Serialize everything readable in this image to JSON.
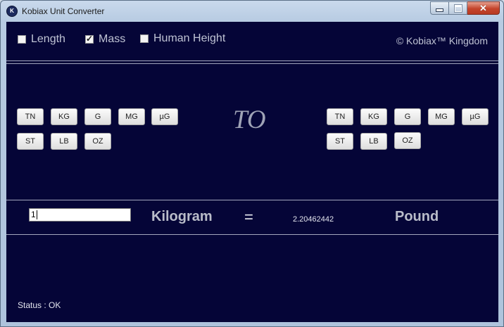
{
  "window": {
    "title": "Kobiax Unit Converter",
    "icon": "kobiax-logo-icon"
  },
  "topbar": {
    "categories": [
      {
        "label": "Length",
        "checked": false
      },
      {
        "label": "Mass",
        "checked": true
      },
      {
        "label": "Human Height",
        "checked": false
      }
    ],
    "copyright": "© Kobiax™ Kingdom"
  },
  "from_units": [
    "TN",
    "KG",
    "G",
    "MG",
    "µG",
    "ST",
    "LB",
    "OZ"
  ],
  "to_label": "TO",
  "to_units": [
    "TN",
    "KG",
    "G",
    "MG",
    "µG",
    "ST",
    "LB",
    "OZ"
  ],
  "conversion": {
    "input_value": "1",
    "from_unit": "Kilogram",
    "equals": "=",
    "result": "2.20462442",
    "to_unit": "Pound"
  },
  "status": "Status : OK",
  "colors": {
    "background": "#050537",
    "text": "#bfc3d4",
    "button": "#e8e8e8"
  }
}
